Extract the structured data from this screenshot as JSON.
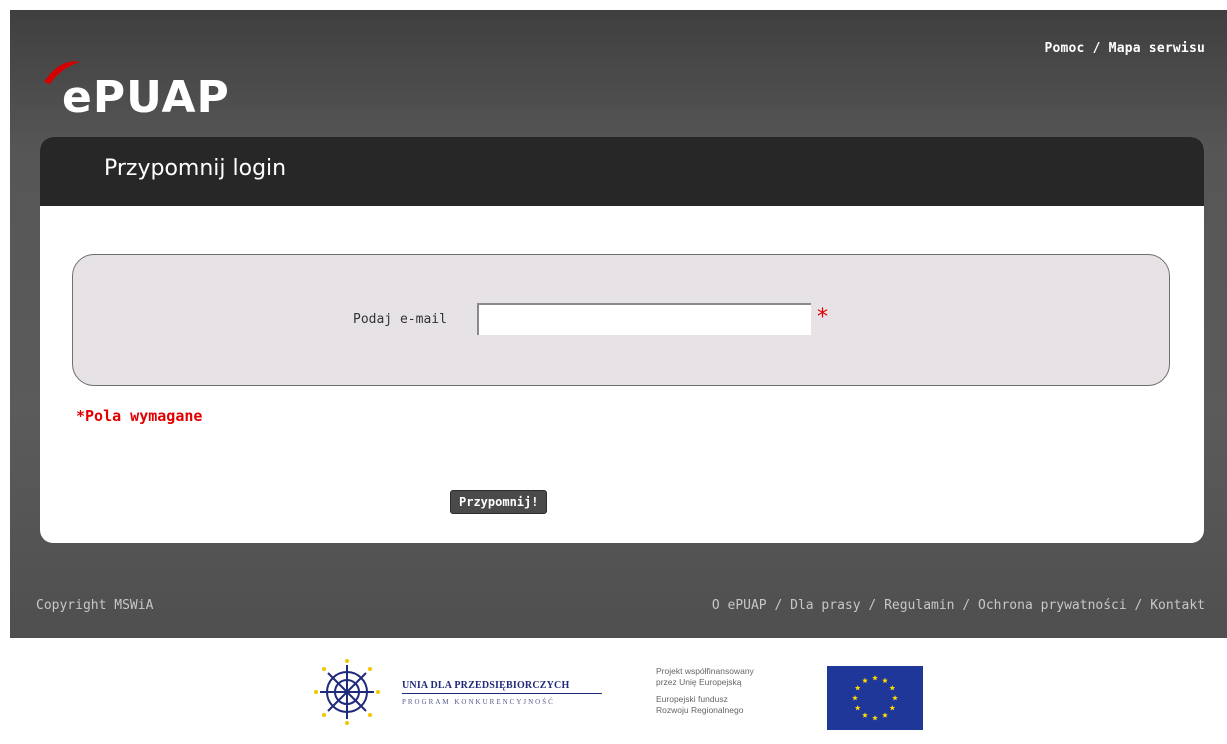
{
  "header": {
    "logo_text": "ePUAP",
    "links": [
      "Pomoc",
      "Mapa serwisu"
    ],
    "separator": " / "
  },
  "panel": {
    "title": "Przypomnij login",
    "email_label": "Podaj e-mail",
    "email_value": "",
    "required_star": "*",
    "required_note": "*Pola wymagane",
    "submit_label": "Przypomnij!"
  },
  "footer": {
    "copyright": "Copyright MSWiA",
    "links": [
      "O ePUAP",
      "Dla prasy",
      "Regulamin",
      "Ochrona prywatności",
      "Kontakt"
    ],
    "separator": " / "
  },
  "sponsors": {
    "unia_title": "UNIA DLA PRZEDSIĘBIORCZYCH",
    "unia_subtitle": "PROGRAM KONKURENCYJNOŚĆ",
    "eu_text_1": "Projekt współfinansowany",
    "eu_text_2": "przez Unię Europejską",
    "eu_text_3": "Europejski fundusz",
    "eu_text_4": "Rozwoju Regionalnego"
  },
  "colors": {
    "accent_red": "#e20000",
    "logo_red": "#d40000",
    "header_dark": "#272727",
    "background_gray": "#565656",
    "form_box": "#e6e2e6",
    "eu_blue": "#1e3799",
    "eu_star": "#ffdd00"
  }
}
